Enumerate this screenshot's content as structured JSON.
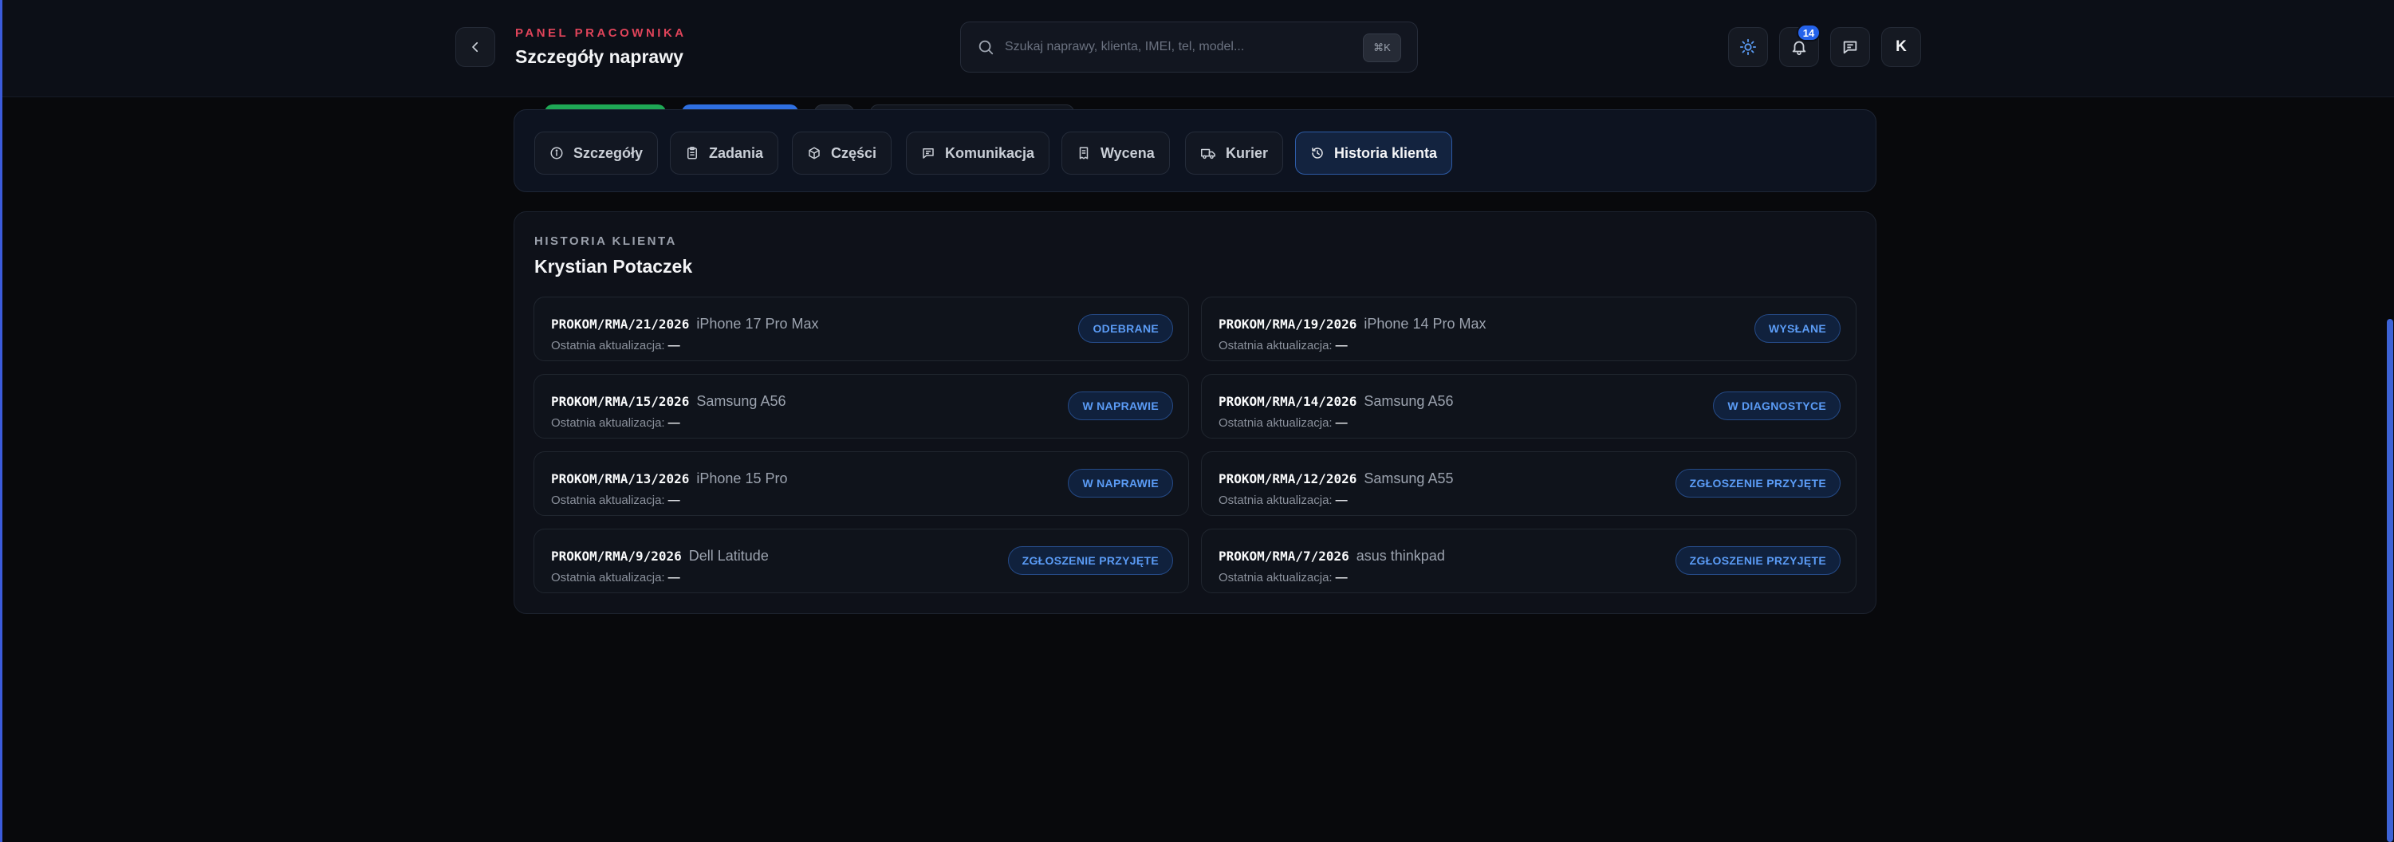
{
  "header": {
    "eyebrow": "PANEL PRACOWNIKA",
    "title": "Szczegóły naprawy",
    "search_placeholder": "Szukaj naprawy, klienta, IMEI, tel, model...",
    "search_shortcut": "⌘K",
    "notifications_count": "14",
    "avatar_initial": "K",
    "icons": [
      "chevron-left-icon",
      "search-icon",
      "sun-icon",
      "bell-icon",
      "message-icon"
    ]
  },
  "tabs": [
    {
      "label": "Szczegóły",
      "icon": "info-icon"
    },
    {
      "label": "Zadania",
      "icon": "clipboard-icon"
    },
    {
      "label": "Części",
      "icon": "box-icon"
    },
    {
      "label": "Komunikacja",
      "icon": "message-icon"
    },
    {
      "label": "Wycena",
      "icon": "receipt-icon"
    },
    {
      "label": "Kurier",
      "icon": "truck-icon"
    },
    {
      "label": "Historia klienta",
      "icon": "history-icon",
      "active": true
    }
  ],
  "history": {
    "section_label": "HISTORIA KLIENTA",
    "client_name": "Krystian Potaczek",
    "update_label": "Ostatnia aktualizacja:",
    "items": [
      {
        "code": "PROKOM/RMA/21/2026",
        "model": "iPhone 17 Pro Max",
        "updated": "—",
        "status": "ODEBRANE"
      },
      {
        "code": "PROKOM/RMA/19/2026",
        "model": "iPhone 14 Pro Max",
        "updated": "—",
        "status": "WYSŁANE"
      },
      {
        "code": "PROKOM/RMA/15/2026",
        "model": "Samsung A56",
        "updated": "—",
        "status": "W NAPRAWIE"
      },
      {
        "code": "PROKOM/RMA/14/2026",
        "model": "Samsung A56",
        "updated": "—",
        "status": "W DIAGNOSTYCE"
      },
      {
        "code": "PROKOM/RMA/13/2026",
        "model": "iPhone 15 Pro",
        "updated": "—",
        "status": "W NAPRAWIE"
      },
      {
        "code": "PROKOM/RMA/12/2026",
        "model": "Samsung A55",
        "updated": "—",
        "status": "ZGŁOSZENIE PRZYJĘTE"
      },
      {
        "code": "PROKOM/RMA/9/2026",
        "model": "Dell Latitude",
        "updated": "—",
        "status": "ZGŁOSZENIE PRZYJĘTE"
      },
      {
        "code": "PROKOM/RMA/7/2026",
        "model": "asus thinkpad",
        "updated": "—",
        "status": "ZGŁOSZENIE PRZYJĘTE"
      }
    ]
  },
  "colors": {
    "background": "#08090c",
    "accent_red": "#e0445a",
    "accent_blue": "#2563eb",
    "status_text": "#5b9cf6"
  }
}
